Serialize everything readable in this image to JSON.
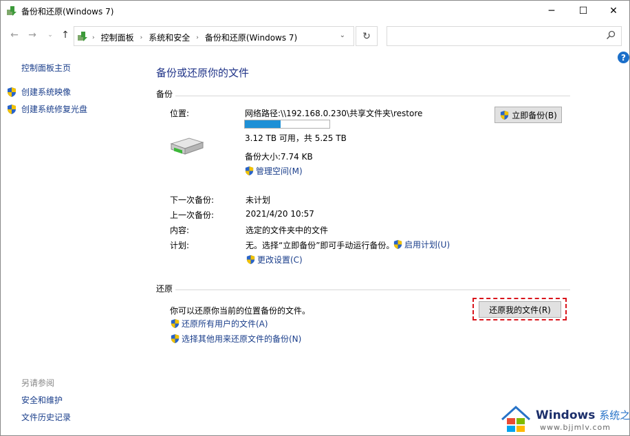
{
  "window": {
    "title": "备份和还原(Windows 7)"
  },
  "titlebar_buttons": {
    "minimize": "─",
    "maximize": "☐",
    "close": "✕"
  },
  "nav": {
    "back_icon": "←",
    "forward_icon": "→",
    "recent_icon": "⌄",
    "up_icon": "↑",
    "breadcrumbs": [
      "控制面板",
      "系统和安全",
      "备份和还原(Windows 7)"
    ],
    "crumb_sep": "›",
    "address_dropdown": "⌄",
    "refresh_icon": "↻",
    "search_placeholder": ""
  },
  "help": {
    "label": "?"
  },
  "sidebar": {
    "home": "控制面板主页",
    "items": [
      {
        "label": "创建系统映像"
      },
      {
        "label": "创建系统修复光盘"
      }
    ],
    "see_also_title": "另请参阅",
    "see_also": [
      {
        "label": "安全和维护"
      },
      {
        "label": "文件历史记录"
      }
    ]
  },
  "main": {
    "title": "备份或还原你的文件",
    "backup": {
      "heading": "备份",
      "location_label": "位置:",
      "location_value": "网络路径:\\\\192.168.0.230\\共享文件夹\\restore",
      "usage_fraction": 0.42,
      "free_space": "3.12 TB 可用，共 5.25 TB",
      "backup_size": "备份大小:7.74 KB",
      "manage_space": "管理空间(M)",
      "backup_now_button": "立即备份(B)",
      "next_label": "下一次备份:",
      "next_value": "未计划",
      "last_label": "上一次备份:",
      "last_value": "2021/4/20 10:57",
      "contents_label": "内容:",
      "contents_value": "选定的文件夹中的文件",
      "schedule_label": "计划:",
      "schedule_value": "无。选择“立即备份”即可手动运行备份。",
      "enable_schedule": "启用计划(U)",
      "change_settings": "更改设置(C)"
    },
    "restore": {
      "heading": "还原",
      "description": "你可以还原你当前的位置备份的文件。",
      "restore_my_files_button": "还原我的文件(R)",
      "restore_all_users": "还原所有用户的文件(A)",
      "select_other_backup": "选择其他用来还原文件的备份(N)"
    }
  },
  "watermark": {
    "brand": "Windows",
    "brand_cn": "系统之家",
    "url": "www.bjjmlv.com"
  },
  "colors": {
    "link": "#1a3e8b",
    "title": "#1e3287",
    "progress": "#1e90d6",
    "highlight": "#d9141b"
  }
}
